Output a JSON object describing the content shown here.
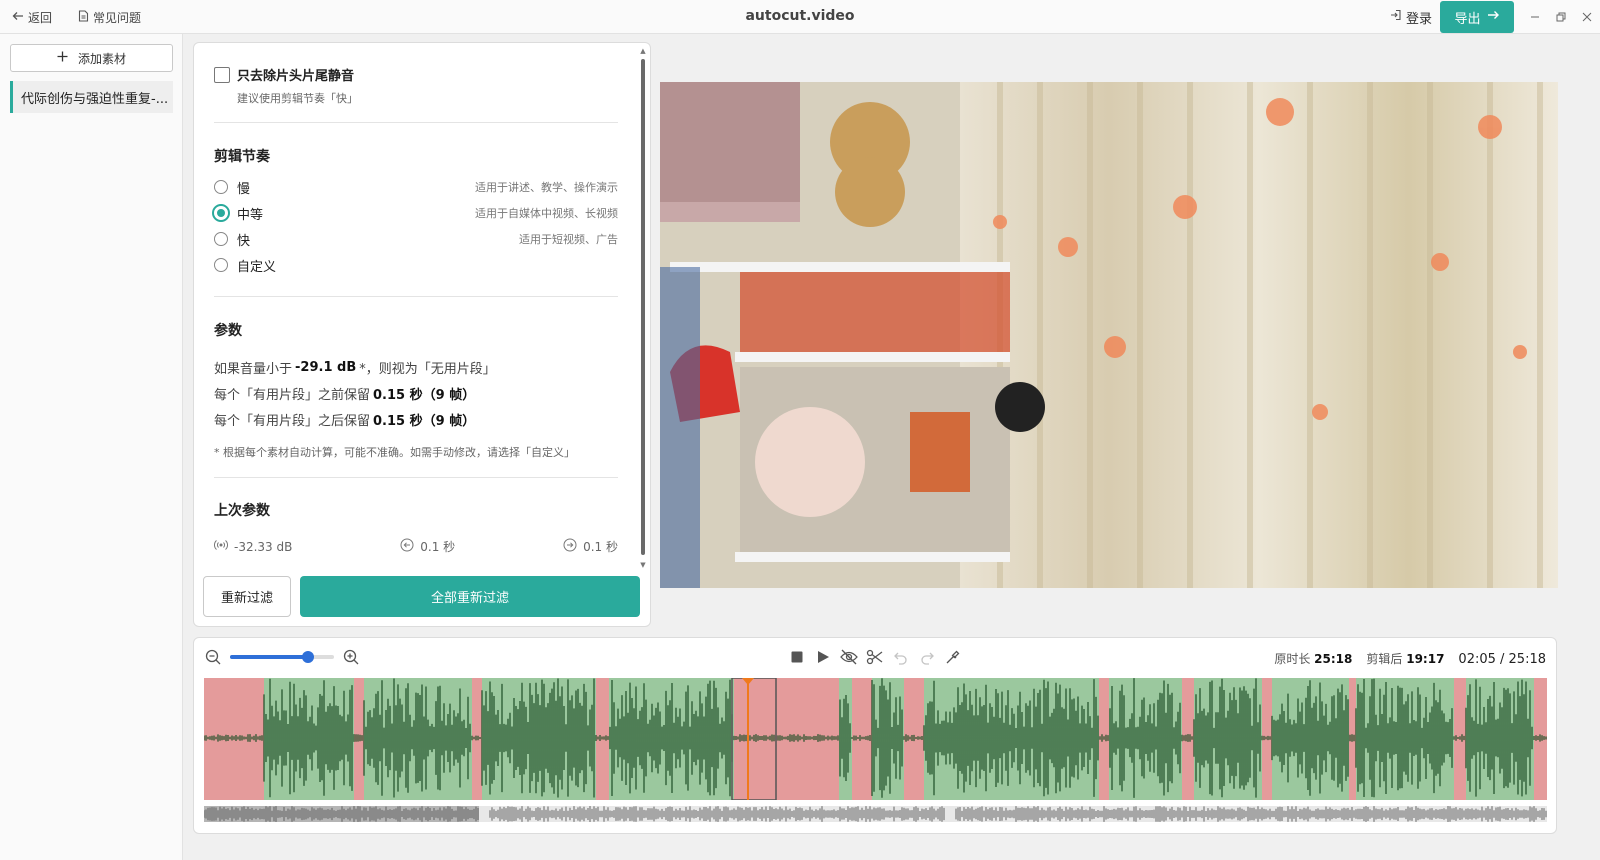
{
  "titlebar": {
    "back_label": "返回",
    "faq_label": "常见问题",
    "app_title": "autocut.video",
    "login_label": "登录",
    "export_label": "导出"
  },
  "sidebar": {
    "add_label": "添加素材",
    "file_name": "代际创伤与强迫性重复-..."
  },
  "settings": {
    "trim_only_label": "只去除片头片尾静音",
    "trim_only_hint": "建议使用剪辑节奏「快」",
    "trim_only_checked": false,
    "pace_title": "剪辑节奏",
    "pace_options": [
      {
        "label": "慢",
        "desc": "适用于讲述、教学、操作演示"
      },
      {
        "label": "中等",
        "desc": "适用于自媒体中视频、长视频"
      },
      {
        "label": "快",
        "desc": "适用于短视频、广告"
      },
      {
        "label": "自定义",
        "desc": ""
      }
    ],
    "pace_selected": "中等",
    "params_title": "参数",
    "param_lines": [
      {
        "pre": "如果音量小于",
        "value": "-29.1 dB",
        "post": "*，则视为「无用片段」"
      },
      {
        "pre": "每个「有用片段」之前保留",
        "value": "0.15 秒（9 帧）",
        "post": ""
      },
      {
        "pre": "每个「有用片段」之后保留",
        "value": "0.15 秒（9 帧）",
        "post": ""
      }
    ],
    "note": "* 根据每个素材自动计算，可能不准确。如需手动修改，请选择「自定义」",
    "last_title": "上次参数",
    "last_params": {
      "volume": "-32.33 dB",
      "before": "0.1 秒",
      "after": "0.1 秒"
    },
    "refilter_label": "重新过滤",
    "refilter_all_label": "全部重新过滤"
  },
  "timeline": {
    "original_label": "原时长",
    "original_value": "25:18",
    "edited_label": "剪辑后",
    "edited_value": "19:17",
    "position": "02:05 / 25:18",
    "zoom_level": 0.75,
    "playhead_fraction": 0.405,
    "colors": {
      "keep": "#9bc89e",
      "cut": "#e49b9b",
      "wave": "#1d4e26",
      "accent": "#2aaa9c",
      "playhead": "#f07a1c"
    }
  }
}
